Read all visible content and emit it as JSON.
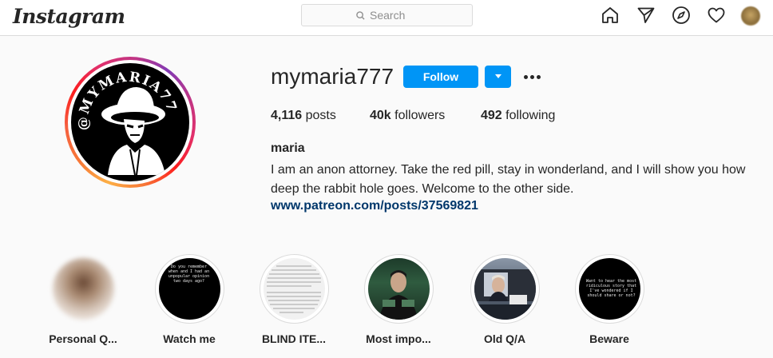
{
  "nav": {
    "logo": "Instagram",
    "search_placeholder": "Search",
    "icons": [
      "home-icon",
      "direct-icon",
      "explore-icon",
      "activity-heart-icon",
      "profile-avatar"
    ]
  },
  "profile": {
    "username": "mymaria777",
    "follow_label": "Follow",
    "avatar_text": "@MYMARIA777",
    "stats": {
      "posts_count": "4,116",
      "posts_label": "posts",
      "followers_count": "40k",
      "followers_label": "followers",
      "following_count": "492",
      "following_label": "following"
    },
    "full_name": "maria",
    "bio": "I am an anon attorney. Take the red pill, stay in wonderland, and I will show you how deep the rabbit hole goes. Welcome to the other side.",
    "link": "www.patreon.com/posts/37569821"
  },
  "highlights": [
    {
      "label": "Personal Q..."
    },
    {
      "label": "Watch me",
      "preview_text": "Do you remember when and I had an unpopular opinion two days ago?"
    },
    {
      "label": "BLIND ITE..."
    },
    {
      "label": "Most impo..."
    },
    {
      "label": "Old Q/A"
    },
    {
      "label": "Beware",
      "preview_text": "Want to hear the most ridiculous story that I've wondered if I should share or not?"
    }
  ],
  "colors": {
    "accent": "#0095f6",
    "link": "#00376b",
    "text": "#262626",
    "muted": "#8e8e8e",
    "border": "#dbdbdb"
  }
}
